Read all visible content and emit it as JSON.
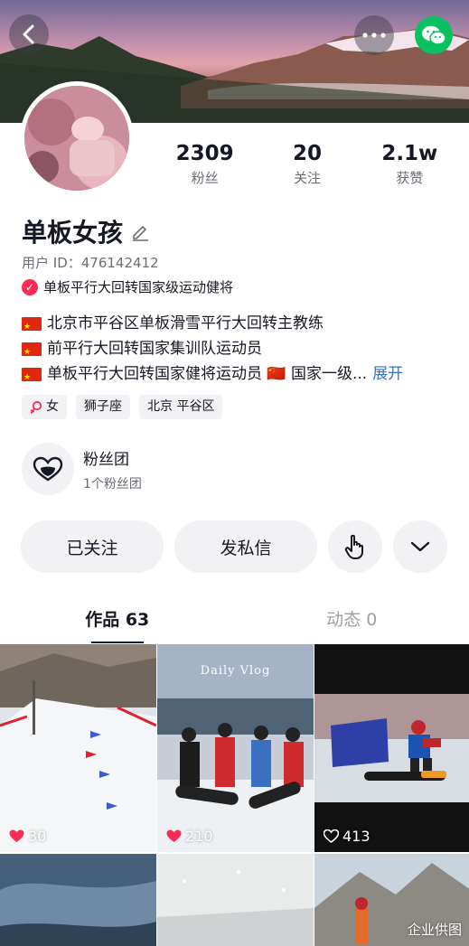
{
  "header": {
    "back_icon": "chevron-left-icon",
    "more_icon": "more-dots-icon",
    "share_icon": "wechat-icon",
    "colors": {
      "wechat_green": "#09c160",
      "accent_red": "#fe2c55"
    }
  },
  "stats": [
    {
      "value": "2309",
      "label": "粉丝"
    },
    {
      "value": "20",
      "label": "关注"
    },
    {
      "value": "2.1w",
      "label": "获赞"
    }
  ],
  "profile": {
    "name": "单板女孩",
    "edit_icon": "pencil-icon",
    "user_id": "用户 ID：476142412",
    "verification": "单板平行大回转国家级运动健将",
    "bio": [
      "北京市平谷区单板滑雪平行大回转主教练",
      "前平行大回转国家集训队运动员",
      "单板平行大回转国家健将运动员 🇨🇳 国家一级..."
    ],
    "expand_label": "展开",
    "tags": [
      "女",
      "狮子座",
      "北京 平谷区"
    ]
  },
  "fan_club": {
    "title": "粉丝团",
    "subtitle": "1个粉丝团"
  },
  "actions": {
    "follow_label": "已关注",
    "message_label": "发私信",
    "touch_icon": "hand-pointer-icon",
    "more_icon": "chevron-down-icon"
  },
  "tabs": [
    {
      "label": "作品 63",
      "active": true
    },
    {
      "label": "动态 0",
      "active": false
    }
  ],
  "videos": [
    {
      "likes": "30",
      "liked": true
    },
    {
      "likes": "210",
      "liked": true
    },
    {
      "likes": "413",
      "liked": false
    }
  ],
  "video2_overlay": {
    "title": "Daily Vlog"
  },
  "watermark": "企业供图"
}
